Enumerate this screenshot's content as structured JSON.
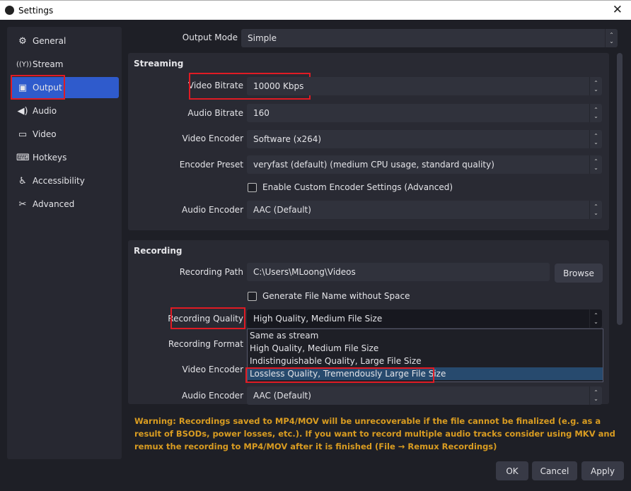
{
  "window": {
    "title": "Settings",
    "close_icon": "close-icon"
  },
  "sidebar": {
    "items": [
      {
        "label": "General",
        "icon": "gear-icon",
        "glyph": "⚙"
      },
      {
        "label": "Stream",
        "icon": "antenna-icon",
        "glyph": "📡"
      },
      {
        "label": "Output",
        "icon": "output-icon",
        "glyph": "🖵",
        "selected": true
      },
      {
        "label": "Audio",
        "icon": "speaker-icon",
        "glyph": "🔊"
      },
      {
        "label": "Video",
        "icon": "monitor-icon",
        "glyph": "🖵"
      },
      {
        "label": "Hotkeys",
        "icon": "keyboard-icon",
        "glyph": "⌨"
      },
      {
        "label": "Accessibility",
        "icon": "accessibility-icon",
        "glyph": "♿"
      },
      {
        "label": "Advanced",
        "icon": "tools-icon",
        "glyph": "✂"
      }
    ]
  },
  "output_mode": {
    "label": "Output Mode",
    "value": "Simple"
  },
  "streaming": {
    "title": "Streaming",
    "video_bitrate": {
      "label": "Video Bitrate",
      "value": "10000 Kbps"
    },
    "audio_bitrate": {
      "label": "Audio Bitrate",
      "value": "160"
    },
    "video_encoder": {
      "label": "Video Encoder",
      "value": "Software (x264)"
    },
    "encoder_preset": {
      "label": "Encoder Preset",
      "value": "veryfast (default) (medium CPU usage, standard quality)"
    },
    "custom_settings": {
      "label": "Enable Custom Encoder Settings (Advanced)",
      "checked": false
    },
    "audio_encoder": {
      "label": "Audio Encoder",
      "value": "AAC (Default)"
    }
  },
  "recording": {
    "title": "Recording",
    "path": {
      "label": "Recording Path",
      "value": "C:\\Users\\MLoong\\Videos",
      "browse": "Browse"
    },
    "no_space": {
      "label": "Generate File Name without Space",
      "checked": false
    },
    "quality": {
      "label": "Recording Quality",
      "value": "High Quality, Medium File Size",
      "options": [
        "Same as stream",
        "High Quality, Medium File Size",
        "Indistinguishable Quality, Large File Size",
        "Lossless Quality, Tremendously Large File Size"
      ],
      "highlighted": 3
    },
    "format": {
      "label": "Recording Format"
    },
    "video_encoder": {
      "label": "Video Encoder"
    },
    "audio_encoder": {
      "label": "Audio Encoder",
      "value": "AAC (Default)"
    }
  },
  "warning": "Warning: Recordings saved to MP4/MOV will be unrecoverable if the file cannot be finalized (e.g. as a result of BSODs, power losses, etc.). If you want to record multiple audio tracks consider using MKV and remux the recording to MP4/MOV after it is finished (File → Remux Recordings)",
  "buttons": {
    "ok": "OK",
    "cancel": "Cancel",
    "apply": "Apply"
  },
  "colors": {
    "accent": "#2f5bcc",
    "highlight_box": "#e01b24",
    "warning": "#d99c21"
  }
}
